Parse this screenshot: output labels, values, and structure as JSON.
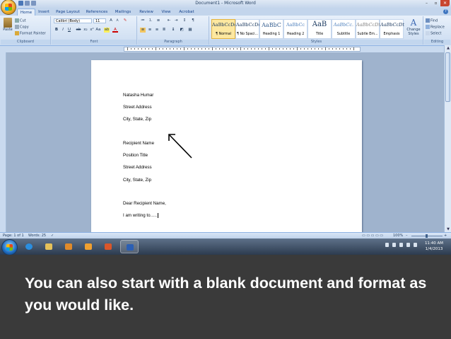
{
  "window": {
    "title": "Document1 - Microsoft Word",
    "controls": {
      "minimize": "–",
      "maximize": "▫",
      "close": "✕"
    }
  },
  "tabs": [
    "Home",
    "Insert",
    "Page Layout",
    "References",
    "Mailings",
    "Review",
    "View",
    "Acrobat"
  ],
  "ribbon": {
    "clipboard": {
      "label": "Clipboard",
      "paste": "Paste",
      "cut": "Cut",
      "copy": "Copy",
      "format_painter": "Format Painter"
    },
    "font": {
      "label": "Font",
      "font_name": "Calibri (Body)",
      "font_size": "11"
    },
    "paragraph": {
      "label": "Paragraph"
    },
    "styles": {
      "label": "Styles",
      "items": [
        {
          "sample": "AaBbCcDc",
          "name": "¶ Normal"
        },
        {
          "sample": "AaBbCcDc",
          "name": "¶ No Spaci..."
        },
        {
          "sample": "AaBbC",
          "name": "Heading 1"
        },
        {
          "sample": "AaBbCc",
          "name": "Heading 2"
        },
        {
          "sample": "AaB",
          "name": "Title"
        },
        {
          "sample": "AaBbCc.",
          "name": "Subtitle"
        },
        {
          "sample": "AaBbCcDt",
          "name": "Subtle Em..."
        },
        {
          "sample": "AaBbCcDt",
          "name": "Emphasis"
        }
      ],
      "change_styles": "Change Styles"
    },
    "editing": {
      "label": "Editing",
      "find": "Find",
      "replace": "Replace",
      "select": "Select"
    }
  },
  "document": {
    "lines": [
      "Natasha Humar",
      "Street Address",
      "City, State, Zip",
      "Recipient Name",
      "Position Title",
      "Street Address",
      "City, State, Zip",
      "Dear Recipient Name,",
      "I am writing to….."
    ]
  },
  "statusbar": {
    "page": "Page: 1 of 1",
    "words": "Words: 25",
    "zoom": "100%"
  },
  "taskbar": {
    "time": "11:40 AM",
    "date": "1/4/2013"
  },
  "caption": "You can also start with a blank document and format as you would like."
}
